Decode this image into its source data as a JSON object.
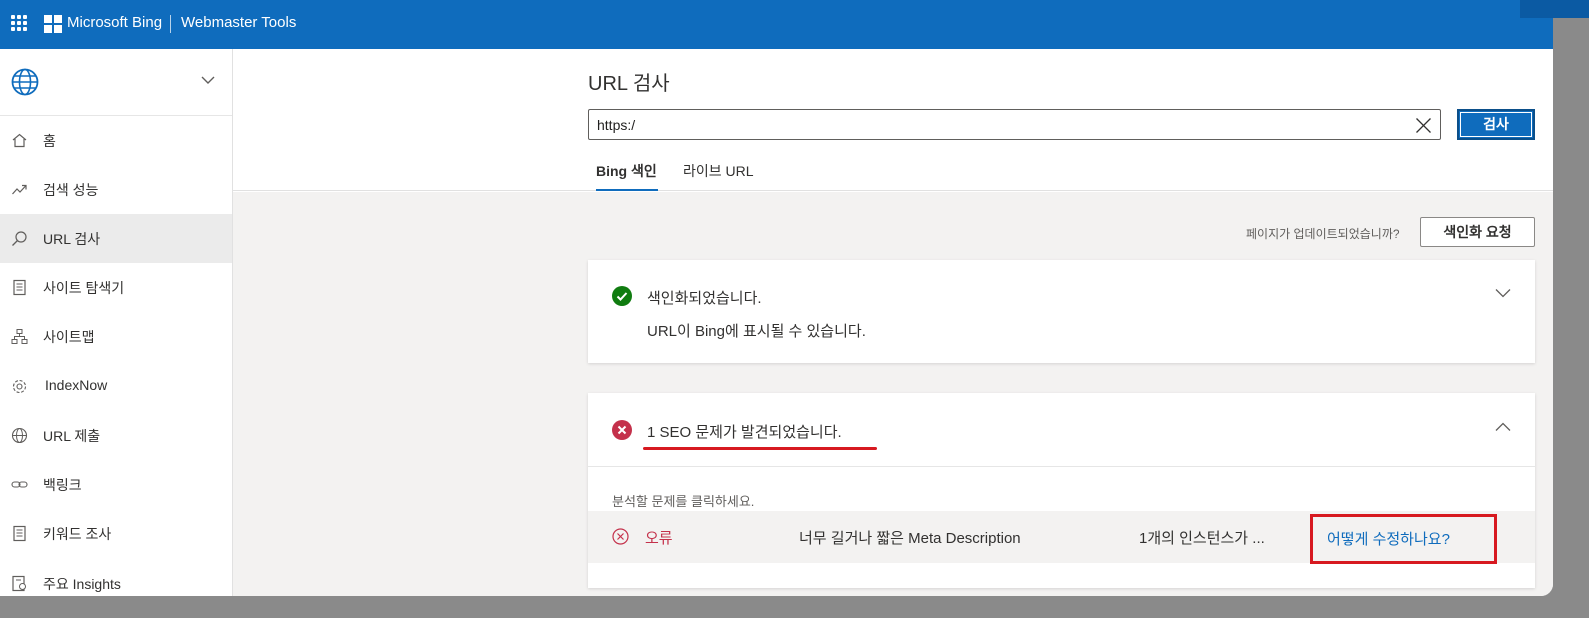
{
  "header": {
    "brand": "Microsoft Bing",
    "product": "Webmaster Tools",
    "accent_color": "#0f6cbd"
  },
  "sidebar": {
    "site_selector_icon": "globe-icon",
    "items": [
      {
        "label": "홈",
        "icon": "home-icon"
      },
      {
        "label": "검색 성능",
        "icon": "trending-icon"
      },
      {
        "label": "URL 검사",
        "icon": "search-icon",
        "active": true
      },
      {
        "label": "사이트 탐색기",
        "icon": "document-icon"
      },
      {
        "label": "사이트맵",
        "icon": "sitemap-icon"
      },
      {
        "label": "IndexNow",
        "icon": "gear-icon"
      },
      {
        "label": "URL 제출",
        "icon": "globe-icon"
      },
      {
        "label": "백링크",
        "icon": "link-icon"
      },
      {
        "label": "키워드 조사",
        "icon": "document-icon"
      },
      {
        "label": "주요 Insights",
        "icon": "insights-icon"
      }
    ]
  },
  "main": {
    "title": "URL 검사",
    "url_value": "https:/",
    "search_button": "검사",
    "tabs": [
      {
        "label": "Bing 색인",
        "active": true
      },
      {
        "label": "라이브 URL",
        "active": false
      }
    ],
    "update_question": "페이지가 업데이트되었습니까?",
    "request_index_button": "색인화 요청",
    "indexed_card": {
      "title": "색인화되었습니다.",
      "subtitle": "URL이 Bing에 표시될 수 있습니다."
    },
    "seo_card": {
      "title": "1 SEO 문제가 발견되었습니다.",
      "hint": "분석할 문제를 클릭하세요.",
      "issue": {
        "severity": "오류",
        "name": "너무 길거나 짧은 Meta Description",
        "count": "1개의 인스턴스가 ...",
        "fix_link": "어떻게 수정하나요?"
      }
    },
    "success_color": "#107c10",
    "error_color": "#c4314b"
  }
}
